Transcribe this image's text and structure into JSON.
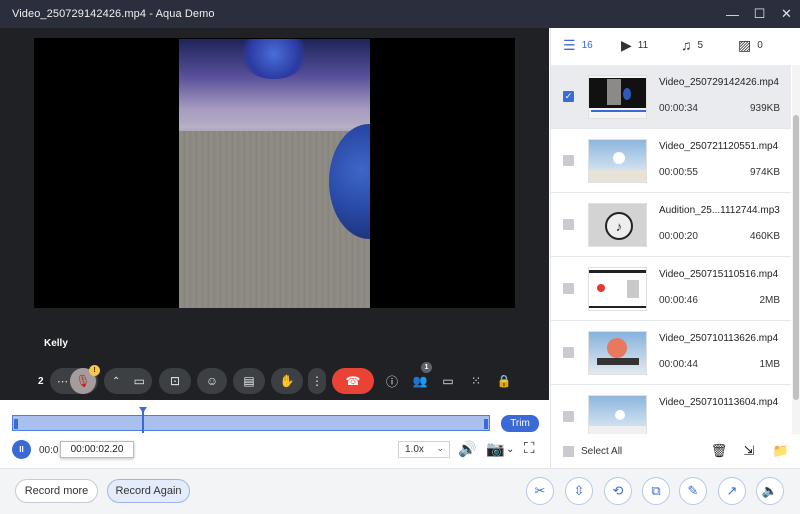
{
  "window": {
    "title": "Video_250729142426.mp4   -   Aqua Demo",
    "controls": {
      "minimize": "—",
      "maximize": "☐",
      "close": "✕"
    }
  },
  "call": {
    "speaker": "Kelly",
    "participants_count": "2",
    "people_badge": "1",
    "mic_warning": "!"
  },
  "tabs": [
    {
      "icon": "list-icon",
      "count": "16"
    },
    {
      "icon": "video-icon",
      "count": "11"
    },
    {
      "icon": "music-icon",
      "count": "5"
    },
    {
      "icon": "image-icon",
      "count": "0"
    }
  ],
  "files": [
    {
      "name": "Video_250729142426.mp4",
      "duration": "00:00:34",
      "size": "939KB",
      "checked": true
    },
    {
      "name": "Video_250721120551.mp4",
      "duration": "00:00:55",
      "size": "974KB",
      "checked": false
    },
    {
      "name": "Audition_25...1112744.mp3",
      "duration": "00:00:20",
      "size": "460KB",
      "checked": false
    },
    {
      "name": "Video_250715110516.mp4",
      "duration": "00:00:46",
      "size": "2MB",
      "checked": false
    },
    {
      "name": "Video_250710113626.mp4",
      "duration": "00:00:44",
      "size": "1MB",
      "checked": false
    },
    {
      "name": "Video_250710113604.mp4",
      "duration": "",
      "size": "",
      "checked": false
    }
  ],
  "footer": {
    "select_all": "Select All"
  },
  "timeline": {
    "trim_label": "Trim",
    "current_time_prefix": "00:0",
    "tooltip_time": "00:00:02.20",
    "speed": "1.0x",
    "pause_icon": "II"
  },
  "bottom": {
    "record_more": "Record more",
    "record_again": "Record Again"
  },
  "colors": {
    "accent": "#3b6ad6",
    "titlebar": "#2b2e3d",
    "hangup": "#ea4335"
  }
}
